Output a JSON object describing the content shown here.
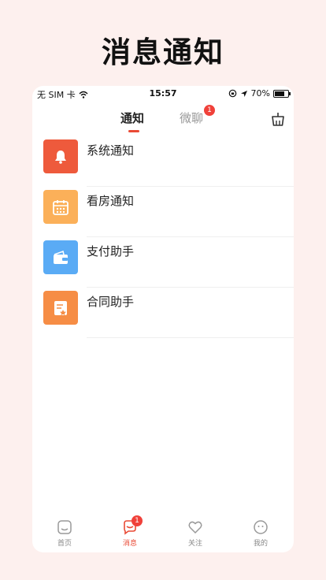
{
  "promo_title": "消息通知",
  "status_bar": {
    "carrier": "无 SIM 卡",
    "time": "15:57",
    "battery": "70%"
  },
  "header": {
    "tabs": [
      {
        "label": "通知",
        "active": true
      },
      {
        "label": "微聊",
        "active": false,
        "badge": "1"
      }
    ]
  },
  "messages": [
    {
      "label": "系统通知",
      "icon": "bell-icon",
      "color": "#ee5a3c"
    },
    {
      "label": "看房通知",
      "icon": "calendar-icon",
      "color": "#fbb059"
    },
    {
      "label": "支付助手",
      "icon": "wallet-icon",
      "color": "#5aabf5"
    },
    {
      "label": "合同助手",
      "icon": "contract-icon",
      "color": "#f68d45"
    }
  ],
  "tabbar": [
    {
      "label": "首页",
      "icon": "home-icon"
    },
    {
      "label": "消息",
      "icon": "message-icon",
      "active": true,
      "badge": "1"
    },
    {
      "label": "关注",
      "icon": "heart-icon"
    },
    {
      "label": "我的",
      "icon": "profile-icon"
    }
  ]
}
